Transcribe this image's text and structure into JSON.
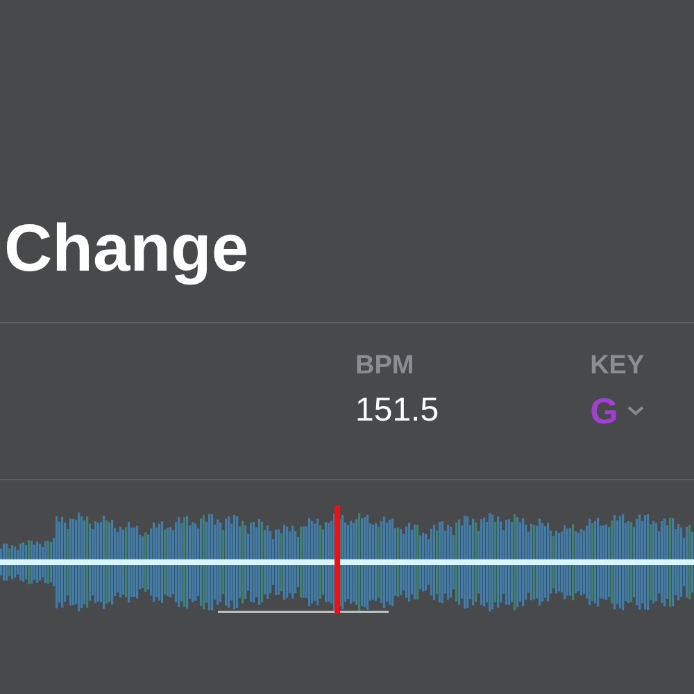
{
  "title": "Change",
  "stats": [
    {
      "kind": "bpm",
      "label": "BPM",
      "value": "151.5"
    },
    {
      "kind": "key",
      "label": "KEY",
      "value": "G"
    }
  ],
  "waveform": {
    "level": 0.486
  }
}
